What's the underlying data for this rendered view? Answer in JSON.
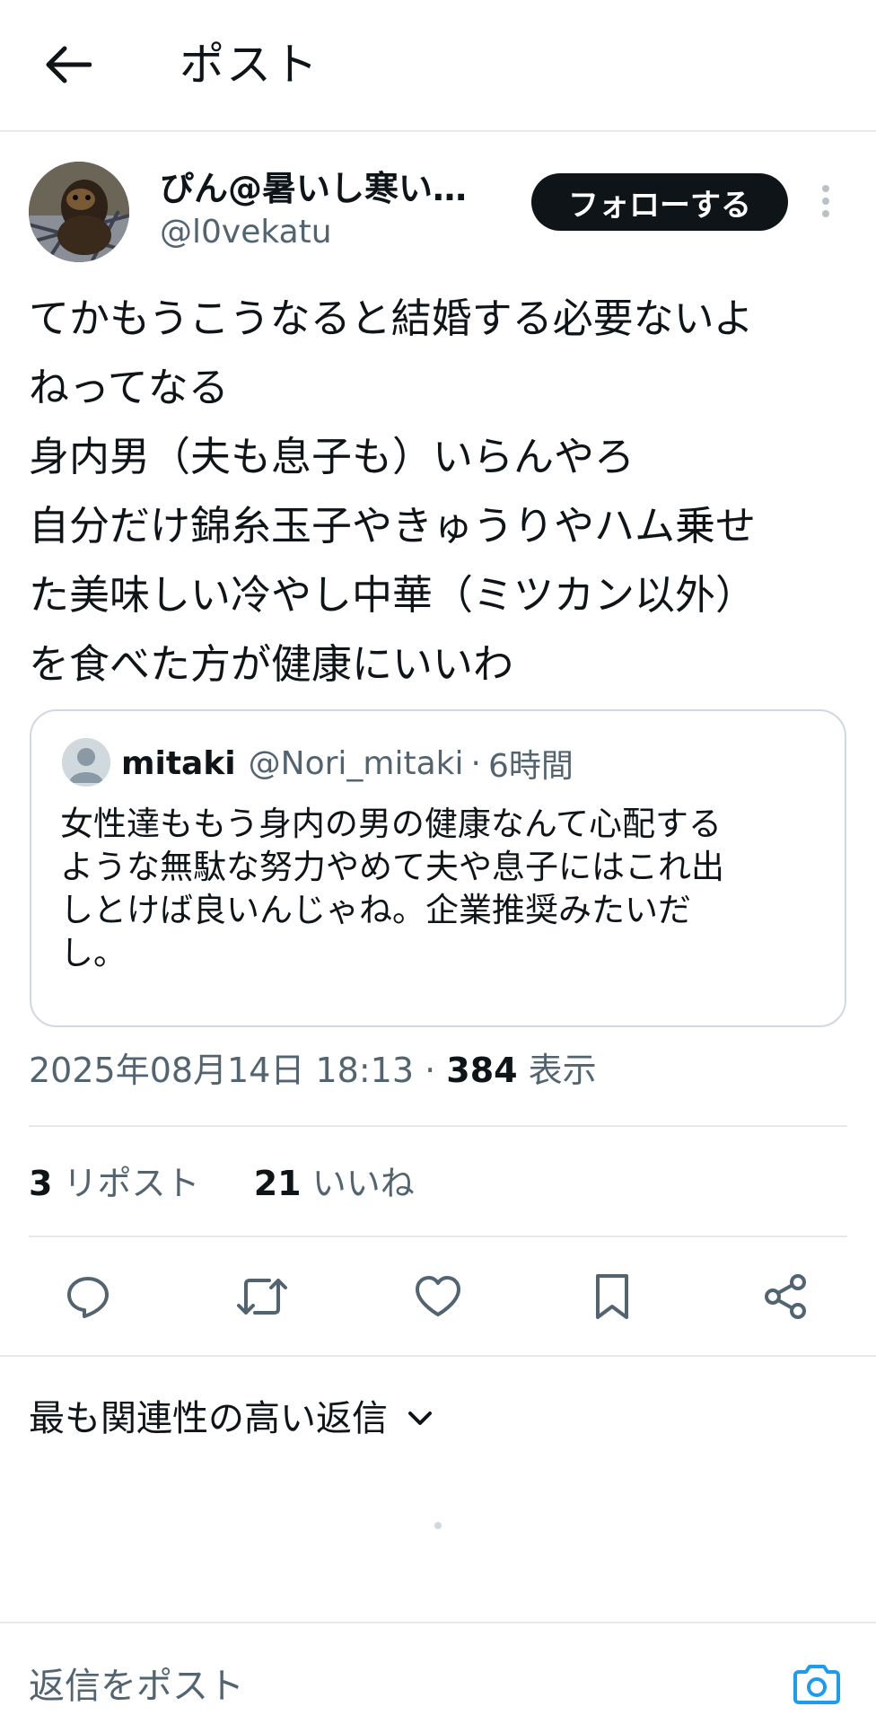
{
  "header": {
    "title": "ポスト",
    "back_icon": "arrow-left-icon"
  },
  "author": {
    "display_name": "ぴん@暑いし寒い…",
    "handle": "@l0vekatu",
    "follow_label": "フォローする"
  },
  "post": {
    "lines": [
      "てかもうこうなると結婚する必要ないよ",
      "ねってなる",
      "身内男（夫も息子も）いらんやろ",
      "自分だけ錦糸玉子やきゅうりやハム乗せ",
      "た美味しい冷やし中華（ミツカン以外）",
      "を食べた方が健康にいいわ"
    ]
  },
  "quote": {
    "name": "mitaki",
    "handle": "@Nori_mitaki",
    "separator": "·",
    "time": "6時間",
    "lines": [
      "女性達ももう身内の男の健康なんて心配する",
      "ような無駄な努力やめて夫や息子にはこれ出",
      "しとけば良いんじゃね。企業推奨みたいだ",
      "し。"
    ]
  },
  "meta": {
    "timestamp": "2025年08月14日 18:13",
    "separator": " · ",
    "views_count": "384",
    "views_label": " 表示"
  },
  "stats": {
    "reposts_count": "3",
    "reposts_label": " リポスト",
    "likes_count": "21",
    "likes_label": " いいね"
  },
  "actions": [
    "reply-icon",
    "repost-icon",
    "like-icon",
    "bookmark-icon",
    "share-icon"
  ],
  "replies": {
    "sort_label": "最も関連性の高い返信"
  },
  "composer": {
    "placeholder": "返信をポスト",
    "camera_icon": "camera-icon"
  },
  "colors": {
    "text": "#0f1419",
    "secondary": "#536471",
    "border": "#cfd9de",
    "accent": "#1d9bf0"
  }
}
